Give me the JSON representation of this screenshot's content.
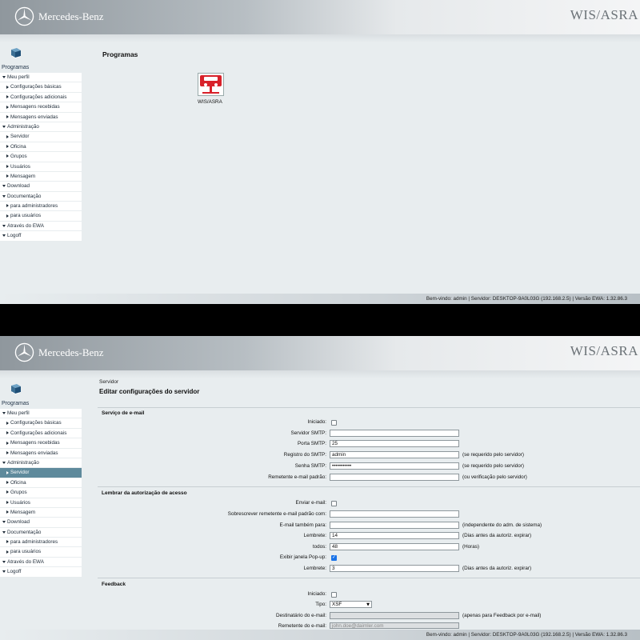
{
  "header": {
    "brand": "Mercedes-Benz",
    "app": "WIS/ASRA"
  },
  "sidebar": {
    "title": "Programas",
    "items": [
      {
        "label": "Meu perfil",
        "level": 1,
        "icon": "down"
      },
      {
        "label": "Configurações básicas",
        "level": 2,
        "icon": "right"
      },
      {
        "label": "Configurações adicionais",
        "level": 2,
        "icon": "right"
      },
      {
        "label": "Mensagens recebidas",
        "level": 2,
        "icon": "right"
      },
      {
        "label": "Mensagens enviadas",
        "level": 2,
        "icon": "right"
      },
      {
        "label": "Administração",
        "level": 1,
        "icon": "down"
      },
      {
        "label": "Servidor",
        "level": 2,
        "icon": "right"
      },
      {
        "label": "Oficina",
        "level": 2,
        "icon": "right"
      },
      {
        "label": "Grupos",
        "level": 2,
        "icon": "right"
      },
      {
        "label": "Usuários",
        "level": 2,
        "icon": "right"
      },
      {
        "label": "Mensagem",
        "level": 2,
        "icon": "right"
      },
      {
        "label": "Download",
        "level": 1,
        "icon": "down"
      },
      {
        "label": "Documentação",
        "level": 1,
        "icon": "down"
      },
      {
        "label": "para administradores",
        "level": 2,
        "icon": "right"
      },
      {
        "label": "para usuários",
        "level": 2,
        "icon": "right"
      },
      {
        "label": "Através do EWA",
        "level": 1,
        "icon": "down"
      },
      {
        "label": "Logoff",
        "level": 1,
        "icon": "down"
      }
    ]
  },
  "footer": {
    "status": "Bem-vindo: admin | Servidor: DESKTOP-9A0L03G (192.168.2.5) | Versão EWA: 1.32.86.3"
  },
  "programs": {
    "title": "Programas",
    "app_label": "WIS/ASRA"
  },
  "server_page": {
    "breadcrumb": "Servidor",
    "title": "Editar configurações do servidor",
    "email_section": {
      "heading": "Serviço de e-mail",
      "iniciado": "Iniciado:",
      "smtp_server": "Servidor SMTP:",
      "smtp_port": "Porta SMTP:",
      "smtp_port_value": "25",
      "smtp_login": "Registro do SMTP:",
      "smtp_login_value": "admin",
      "smtp_login_hint": "(se requerido pelo servidor)",
      "smtp_password": "Senha SMTP:",
      "smtp_password_value": "•••••••••••",
      "smtp_password_hint": "(se requerido pelo servidor)",
      "sender_default": "Remetente e-mail padrão:",
      "sender_hint": "(ou verificação pelo servidor)"
    },
    "reminder_section": {
      "heading": "Lembrar da autorização de acesso",
      "send_email": "Enviar e-mail:",
      "overwrite_sender": "Sobrescrever remetente e-mail padrão com:",
      "email_also": "E-mail também para:",
      "email_also_hint": "(independente do adm. de sistema)",
      "reminder": "Lembrete:",
      "reminder_value": "14",
      "reminder_hint": "(Dias antes da autoriz. expirar)",
      "every": "todos:",
      "every_value": "48",
      "every_hint": "(Horas)",
      "popup": "Exibir janela Pop-up:",
      "reminder2": "Lembrete:",
      "reminder2_value": "3",
      "reminder2_hint": "(Dias antes da autoriz. expirar)"
    },
    "feedback_section": {
      "heading": "Feedback",
      "iniciado": "Iniciado:",
      "type": "Tipo:",
      "type_value": "XSF",
      "recipient": "Destinatário do e-mail:",
      "recipient_hint": "(apenas para Feedback por e-mail)",
      "sender": "Remetente do e-mail:",
      "sender_value": "john.doe@daimler.com"
    }
  }
}
